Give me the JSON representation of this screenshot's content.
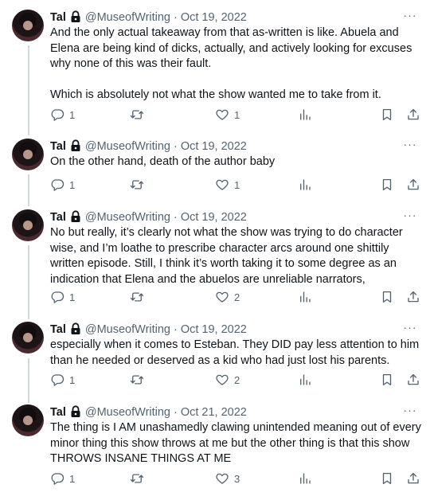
{
  "tweets": [
    {
      "name": "Tal",
      "handle": "@MuseofWriting",
      "separator": "·",
      "date": "Oct 19, 2022",
      "paragraphs": [
        "And the only actual takeaway from that as-written is like. Abuela and Elena are being kind of dicks, actually, and actively looking for excuses why none of this was their fault.",
        "Which is absolutely not what the show wanted me to take from it."
      ],
      "replies": "1",
      "retweets": "",
      "likes": "1"
    },
    {
      "name": "Tal",
      "handle": "@MuseofWriting",
      "separator": "·",
      "date": "Oct 19, 2022",
      "paragraphs": [
        "On the other hand, death of the author baby"
      ],
      "replies": "1",
      "retweets": "",
      "likes": "1"
    },
    {
      "name": "Tal",
      "handle": "@MuseofWriting",
      "separator": "·",
      "date": "Oct 19, 2022",
      "paragraphs": [
        "No but really, it’s clearly not what the show was trying to do character wise, and I’m loathe to prescribe character arcs around one shittily written episode. Still, I think it’s worth taking it to some degree as an indication that Elena and the abuelos are unreliable narrators,"
      ],
      "replies": "1",
      "retweets": "",
      "likes": "2"
    },
    {
      "name": "Tal",
      "handle": "@MuseofWriting",
      "separator": "·",
      "date": "Oct 19, 2022",
      "paragraphs": [
        "especially when it comes to Esteban. They DID pay less attention to him than he needed or deserved as a kid who had just lost his parents."
      ],
      "replies": "1",
      "retweets": "",
      "likes": "2"
    },
    {
      "name": "Tal",
      "handle": "@MuseofWriting",
      "separator": "·",
      "date": "Oct 21, 2022",
      "paragraphs": [
        "The thing is I AM unashamedly clawing unintended meaning out of every minor thing this show throws at me but the other thing is that this show THROWS INSANE THINGS AT ME"
      ],
      "replies": "1",
      "retweets": "",
      "likes": "3"
    }
  ],
  "more_label": "···",
  "icons": {
    "lock": "lock-icon",
    "reply": "reply-icon",
    "retweet": "retweet-icon",
    "like": "heart-icon",
    "views": "views-icon",
    "bookmark": "bookmark-icon",
    "share": "share-icon"
  },
  "colors": {
    "text": "#0f1419",
    "secondary": "#536471",
    "thread_line": "#cfd9de"
  }
}
